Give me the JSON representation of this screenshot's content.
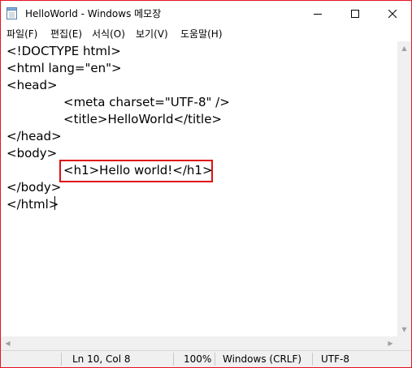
{
  "window": {
    "title": "HelloWorld - Windows 메모장",
    "accent_color": "#e81123"
  },
  "menu": {
    "items": [
      {
        "label": "파일(F)"
      },
      {
        "label": "편집(E)"
      },
      {
        "label": "서식(O)"
      },
      {
        "label": "보기(V)"
      },
      {
        "label": "도움말(H)"
      }
    ]
  },
  "editor": {
    "lines": [
      "<!DOCTYPE html>",
      "<html lang=\"en\">",
      "<head>",
      "\t<meta charset=\"UTF-8\" />",
      "\t<title>HelloWorld</title>",
      "</head>",
      "<body>",
      "\t<h1>Hello world!</h1>",
      "</body>",
      "</html>"
    ],
    "highlighted_line": 8,
    "highlight_color": "#e01010"
  },
  "status": {
    "position": "Ln 10, Col 8",
    "zoom": "100%",
    "line_ending": "Windows (CRLF)",
    "encoding": "UTF-8"
  },
  "icons": {
    "app": "notepad-icon",
    "minimize": "minimize-icon",
    "maximize": "maximize-icon",
    "close": "close-icon"
  }
}
